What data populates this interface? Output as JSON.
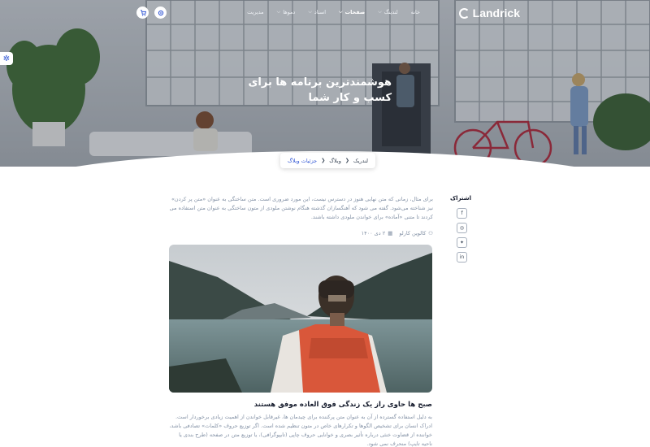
{
  "nav": {
    "logo": "Landrick",
    "menu": [
      {
        "label": "خانه",
        "caret": false,
        "active": false
      },
      {
        "label": "لندینگ",
        "caret": true,
        "active": false
      },
      {
        "label": "صفحات",
        "caret": true,
        "active": true
      },
      {
        "label": "اسناد",
        "caret": true,
        "active": false
      },
      {
        "label": "دموها",
        "caret": true,
        "active": false
      },
      {
        "label": "مدیریت",
        "caret": false,
        "active": false
      }
    ],
    "cart_icon": "cart-icon",
    "settings_icon": "gear-icon"
  },
  "hero": {
    "title_line1": "هوشمندترین برنامه ها برای",
    "title_line2": "کسب و کار شما"
  },
  "breadcrumb": {
    "items": [
      "لندریک",
      "وبلاگ",
      "جزئیات وبلاگ"
    ]
  },
  "content": {
    "intro": "برای مثال، زمانی که متن نهایی هنوز در دسترس نیست، این مورد ضروری است. متن ساختگی به عنوان «متن پر کردن» نیز شناخته می‌شود. گفته می شود که آهنگسازان گذشته هنگام نوشتن ملودی از متون ساختگی به عنوان متن استفاده می کردند تا متنی «آماده» برای خواندن ملودی داشته باشند.",
    "author": "کالوین کارلو",
    "date": "۲ دی ۱۴۰۰",
    "post_title": "صبح ها حاوی راز یک زندگی فوق العاده موفق هستند",
    "post_body": "به دلیل استفاده گسترده از آن به عنوان متن پرکننده برای چیدمان ها، غیرقابل خواندن از اهمیت زیادی برخوردار است. ادراک انسان برای تشخیص الگوها و تکرارهای خاص در متون تنظیم شده است. اگر توزیع حروف «کلمات» تصادفی باشد، خواننده از قضاوت خنثی درباره تأثیر بصری و خوانایی حروف چاپی (تایپوگرافی)، یا توزیع متن در صفحه (طرح بندی یا ناحیه تایپ) منحرف نمی شود."
  },
  "share": {
    "label": "اشتراک",
    "buttons": [
      "facebook-icon",
      "instagram-icon",
      "twitter-icon",
      "linkedin-icon"
    ]
  },
  "colors": {
    "primary": "#2f55d4",
    "heading": "#161c2d",
    "muted": "#8492a6"
  }
}
